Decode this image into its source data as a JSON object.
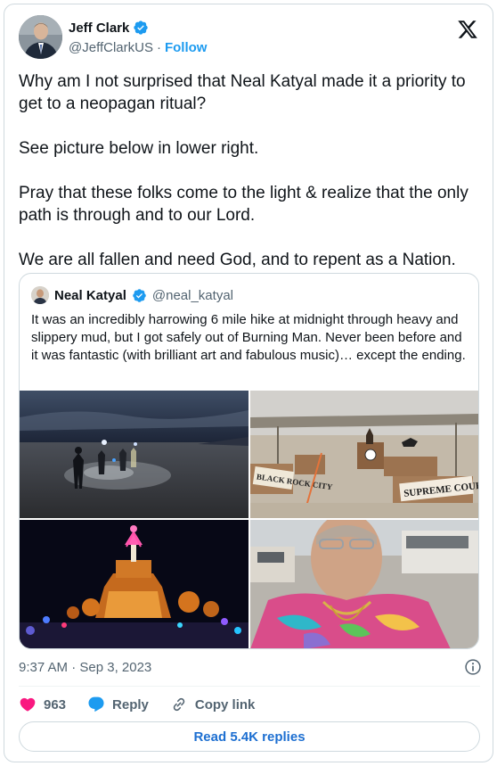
{
  "author": {
    "name": "Jeff Clark",
    "handle": "@JeffClarkUS",
    "separator": "·",
    "follow": "Follow"
  },
  "tweet": {
    "paragraphs": [
      "Why am I not surprised that Neal Katyal made it a priority to get to a neopagan ritual?",
      "See picture below in lower right.",
      "Pray that these folks come to the light & realize that the only path is through and to our Lord.",
      "We are all fallen and need God, and to repent as a Nation."
    ]
  },
  "quoted": {
    "name": "Neal Katyal",
    "handle": "@neal_katyal",
    "text": "It was an incredibly harrowing 6 mile hike at midnight through heavy and slippery mud, but I got safely out of Burning Man. Never been before and it was fantastic (with brilliant art and fabulous music)… except the ending.",
    "photo_signs": {
      "left": "BLACK ROCK CITY",
      "right": "SUPREME COURT"
    }
  },
  "meta": {
    "timestamp": "9:37 AM · Sep 3, 2023"
  },
  "actions": {
    "likes": "963",
    "reply": "Reply",
    "copy_link": "Copy link"
  },
  "footer": {
    "read_replies": "Read 5.4K replies"
  },
  "colors": {
    "like": "#f91880",
    "reply": "#1d9bf0",
    "verified": "#1d9bf0",
    "link": "#1d6fd1"
  }
}
